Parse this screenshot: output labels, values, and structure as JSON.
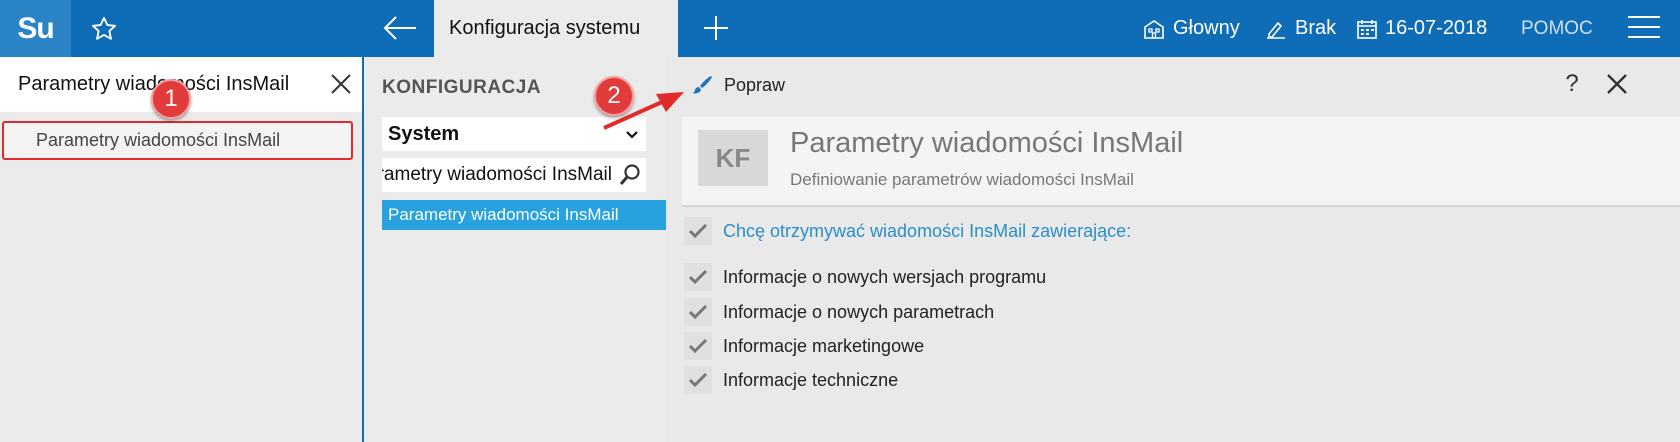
{
  "topbar": {
    "logo": "Su",
    "active_tab": "Konfiguracja systemu",
    "main_label": "Głowny",
    "brak_label": "Brak",
    "date": "16-07-2018",
    "help": "POMOC"
  },
  "left": {
    "search_value": "Parametry wiadomości InsMail",
    "result": "Parametry wiadomości InsMail"
  },
  "middle": {
    "title": "KONFIGURACJA",
    "select_value": "System",
    "search_value": "Parametry wiadomości InsMail",
    "selected_item": "Parametry wiadomości InsMail"
  },
  "content": {
    "edit_label": "Popraw",
    "help_label": "?",
    "badge": "KF",
    "title": "Parametry wiadomości InsMail",
    "subtitle": "Definiowanie parametrów wiadomości InsMail",
    "options": [
      "Chcę otrzymywać wiadomości InsMail zawierające:",
      "Informacje o nowych wersjach programu",
      "Informacje o nowych parametrach",
      "Informacje marketingowe",
      "Informacje techniczne"
    ]
  },
  "annotations": {
    "step1": "1",
    "step2": "2"
  },
  "colors": {
    "topbar": "#0f6cb6",
    "selection": "#27a2df",
    "highlight": "#e22a2a"
  }
}
